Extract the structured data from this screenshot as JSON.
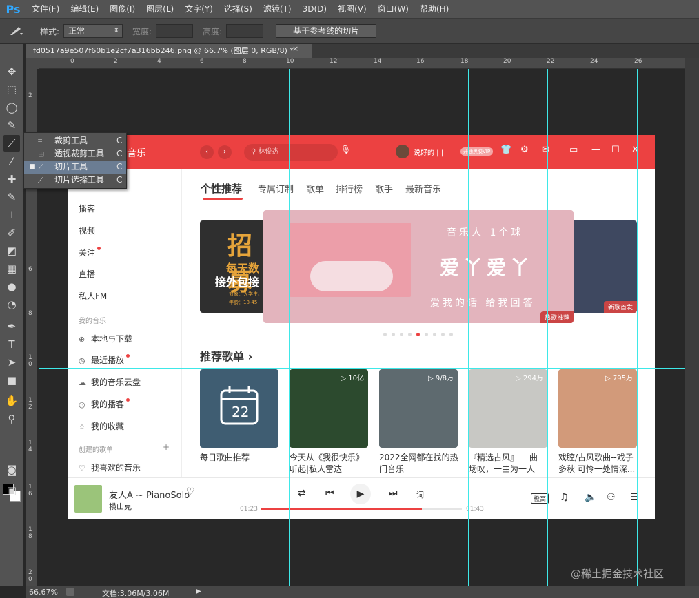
{
  "app": {
    "logo": "Ps"
  },
  "menu": [
    "文件(F)",
    "编辑(E)",
    "图像(I)",
    "图层(L)",
    "文字(Y)",
    "选择(S)",
    "滤镜(T)",
    "3D(D)",
    "视图(V)",
    "窗口(W)",
    "帮助(H)"
  ],
  "options": {
    "style_label": "样式:",
    "style_value": "正常",
    "width_label": "宽度:",
    "height_label": "高度:",
    "slice_button": "基于参考线的切片"
  },
  "document": {
    "tab_title": "fd0517a9e507f60b1e2cf7a316bb246.png @ 66.7% (图层 0, RGB/8) *",
    "close": "×"
  },
  "ruler_top": [
    "0",
    "2",
    "4",
    "6",
    "8",
    "10",
    "12",
    "14",
    "16",
    "18",
    "20",
    "22",
    "24",
    "26"
  ],
  "ruler_left": [
    "2",
    "4",
    "6",
    "8",
    "1\n0",
    "1\n2",
    "1\n4",
    "1\n6",
    "1\n8",
    "2\n0"
  ],
  "flyout": {
    "items": [
      {
        "label": "裁剪工具",
        "key": "C",
        "icon": "crop-icon"
      },
      {
        "label": "透视裁剪工具",
        "key": "C",
        "icon": "perspective-crop-icon"
      },
      {
        "label": "切片工具",
        "key": "C",
        "icon": "slice-icon",
        "active": true
      },
      {
        "label": "切片选择工具",
        "key": "C",
        "icon": "slice-select-icon"
      }
    ],
    "bullet": "■"
  },
  "music": {
    "logo": "音乐",
    "back": "‹",
    "forward": "›",
    "search_placeholder": "林俊杰",
    "username": "说好的 | |",
    "vip": "开通黑胶VIP",
    "sidebar": {
      "top": [
        "播客",
        "视频",
        "关注",
        "直播",
        "私人FM"
      ],
      "my_music_title": "我的音乐",
      "my_music": [
        "本地与下载",
        "最近播放",
        "我的音乐云盘",
        "我的播客",
        "我的收藏"
      ],
      "created_title": "创建的歌单",
      "created": [
        "我喜欢的音乐"
      ]
    },
    "tabs": [
      "个性推荐",
      "专属订制",
      "歌单",
      "排行榜",
      "歌手",
      "最新音乐"
    ],
    "banner_left": {
      "t1": "招募",
      "t2": "每天数",
      "t3": "接外包接",
      "t4": "对象：大学生、",
      "t5": "年龄：18-45"
    },
    "banner_main": {
      "line1": "音乐人 1个球",
      "line2": "爱丫爱丫",
      "line3": "爱我的话 给我回答",
      "badge": "热歌推荐"
    },
    "banner_right": {
      "badge": "新歌首发"
    },
    "section_title": "推荐歌单 ›",
    "cards": [
      {
        "title": "每日歌曲推荐",
        "count": "",
        "date": "22",
        "color": "#3f5d72"
      },
      {
        "title": "今天从《我很快乐》听起|私人雷达",
        "count": "▷ 10亿",
        "color": "#2c4a2e"
      },
      {
        "title": "2022全网都在找的热门音乐",
        "count": "▷ 9/8万",
        "color": "#5e6a6f"
      },
      {
        "title": "『精选古风』 一曲一场叹，一曲为一人",
        "count": "▷ 294万",
        "color": "#c8c8c4"
      },
      {
        "title": "戏腔/古风歌曲--戏子多秋 可怜一处情深...",
        "count": "▷ 795万",
        "color": "#d29a7a"
      }
    ],
    "player": {
      "song": "友人A ~ PianoSolo",
      "artist": "横山克",
      "time_current": "01:23",
      "time_total": "01:43",
      "progress": 0.8,
      "quality": "极高",
      "lyrics": "词"
    }
  },
  "status": {
    "zoom": "66.67%",
    "doc": "文档:3.06M/3.06M",
    "arrow": "▶"
  },
  "watermark": "@稀土掘金技术社区"
}
